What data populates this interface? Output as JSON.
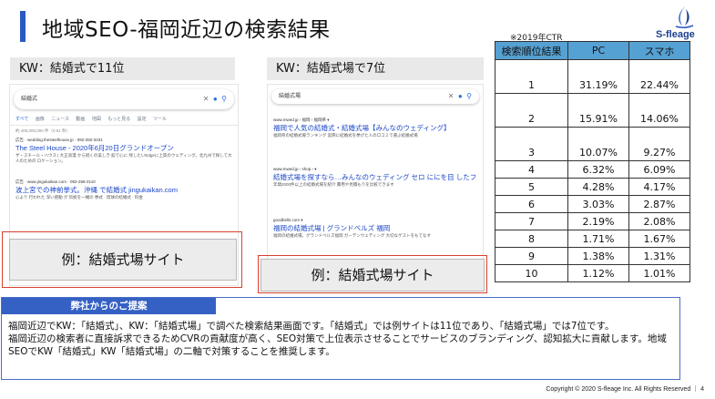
{
  "slide": {
    "title": "地域SEO-福岡近辺の検索結果"
  },
  "logo": {
    "text": "S-fleage",
    "colors": {
      "mark": "#2b59c3",
      "text": "#1d3f8f"
    }
  },
  "panels": [
    {
      "keyword_label": "KW：結婚式で11位",
      "search_query": "結婚式",
      "tabs": [
        "すべて",
        "画像",
        "ニュース",
        "動画",
        "地図",
        "もっと見る",
        "設定",
        "ツール"
      ],
      "result_count": "約 400,000,000 件（0.51 秒）",
      "results": [
        {
          "url": "広告 · wedding.thesteelhouse.jp · 092-282-3431",
          "title": "The Steel House - 2020年6月20日グランドオープン",
          "desc": "ザ・スチール・ハウス | 大正浪漫 から続くの美しき 館で心に 残したいEdgeに上質のウェディング。北九州で探して大人のための ロケーション。"
        },
        {
          "url": "広告 · www.jingukaikan.com · 092-268-2110",
          "title": "波上宮での神前挙式。沖縄 で結婚式 jingukaikan.com",
          "desc": "心より 行われた 深い感動 が 伝統を一緒の 挙式 · 琉球の結婚式 · 料金"
        }
      ],
      "example_label": "例：結婚式場サイト"
    },
    {
      "keyword_label": "KW：結婚式場で7位",
      "search_query": "結婚式場",
      "tabs": [],
      "result_count": "",
      "results": [
        {
          "url": "www.mwed.jp › 福岡 › 福岡県 ▾",
          "title": "福岡で人気の結婚式・結婚式場【みんなのウェディング】",
          "desc": "福岡県の結婚式場ランキング 実際に結婚式を挙げた人の口コミで選ぶ結婚式場"
        },
        {
          "url": "www.mwed.jp › shop › ▾",
          "title": "結婚式場を探すなら…みんなのウェディング セロ ににを目 したフェア",
          "desc": "年間2000件以上の結婚式場を紹介 費用や見積もりを比較できます"
        },
        {
          "url": "goodbells.com ▾",
          "title": "福岡の結婚式場 | グランドベルズ 福岡",
          "desc": "福岡の結婚式場。グランドベルズ福岡 ガーデンウェディング 大切なゲストをもてなす"
        }
      ],
      "example_label": "例：結婚式場サイト"
    }
  ],
  "ctr_table": {
    "note": "※2019年CTR",
    "headers": [
      "検索順位結果",
      "PC",
      "スマホ"
    ],
    "header_color": "#56a1d3",
    "rows": [
      {
        "rank": "1",
        "pc": "31.19%",
        "sp": "22.44%"
      },
      {
        "rank": "2",
        "pc": "15.91%",
        "sp": "14.06%"
      },
      {
        "rank": "3",
        "pc": "10.07%",
        "sp": "9.27%"
      },
      {
        "rank": "4",
        "pc": "6.32%",
        "sp": "6.09%"
      },
      {
        "rank": "5",
        "pc": "4.28%",
        "sp": "4.17%"
      },
      {
        "rank": "6",
        "pc": "3.03%",
        "sp": "2.87%"
      },
      {
        "rank": "7",
        "pc": "2.19%",
        "sp": "2.08%"
      },
      {
        "rank": "8",
        "pc": "1.71%",
        "sp": "1.67%"
      },
      {
        "rank": "9",
        "pc": "1.38%",
        "sp": "1.31%"
      },
      {
        "rank": "10",
        "pc": "1.12%",
        "sp": "1.01%"
      }
    ]
  },
  "proposal": {
    "heading": "弊社からのご提案",
    "paragraphs": [
      "福岡近辺でKW：「結婚式」、KW：「結婚式場」で調べた検索結果画面です。「結婚式」では例サイトは11位であり、「結婚式場」では7位です。",
      "福岡近辺の検索者に直接訴求できるためCVRの貢献度が高く、SEO対策で上位表示させることでサービスのブランディング、認知拡大に貢献します。地域SEOでKW「結婚式」KW「結婚式場」の二軸で対策することを推奨します。"
    ],
    "colors": {
      "header": "#3561c4",
      "border": "#4a6fc8"
    }
  },
  "footer": {
    "copyright": "Copyright © 2020 S-fleage Inc. All Rights Reserved ｜ 4"
  }
}
